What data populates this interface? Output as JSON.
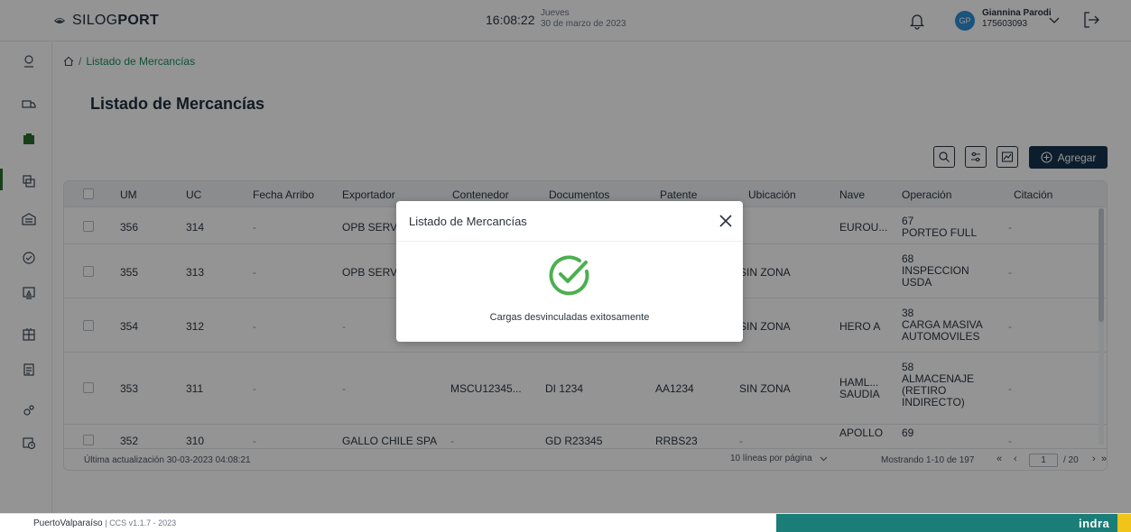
{
  "header": {
    "brand_light": "SILOG",
    "brand_bold": "PORT",
    "time": "16:08:22",
    "day": "Jueves",
    "date": "30 de marzo de 2023",
    "user_initials": "GP",
    "user_name": "Giannina Parodi",
    "user_id": "175603093"
  },
  "breadcrumb": {
    "separator": "/",
    "current": "Listado de Mercancías"
  },
  "page_title": "Listado de Mercancías",
  "toolbar": {
    "add_label": "Agregar"
  },
  "table": {
    "columns": [
      "UM",
      "UC",
      "Fecha Arribo",
      "Exportador",
      "Contenedor",
      "Documentos",
      "Patente",
      "Ubicación",
      "Nave",
      "Operación",
      "Citación"
    ],
    "rows": [
      {
        "um": "356",
        "uc": "314",
        "fecha": "-",
        "exportador": "OPB SERVIC",
        "contenedor": "",
        "documentos": "",
        "patente": "",
        "ubicacion": "",
        "nave": "EUROU...",
        "op_num": "67",
        "op_text": "PORTEO FULL",
        "citacion": "-"
      },
      {
        "um": "355",
        "uc": "313",
        "fecha": "-",
        "exportador": "OPB SERVIC",
        "contenedor": "",
        "documentos": "",
        "patente": "",
        "ubicacion": "SIN ZONA",
        "nave": "",
        "op_num": "68",
        "op_text": "INSPECCION USDA",
        "citacion": "-"
      },
      {
        "um": "354",
        "uc": "312",
        "fecha": "-",
        "exportador": "-",
        "contenedor": "",
        "documentos": "",
        "patente": "",
        "ubicacion": "SIN ZONA",
        "nave": "HERO A",
        "op_num": "38",
        "op_text": "CARGA MASIVA AUTOMOVILES",
        "citacion": "-"
      },
      {
        "um": "353",
        "uc": "311",
        "fecha": "-",
        "exportador": "-",
        "contenedor": "MSCU12345...",
        "documentos": "DI 1234",
        "patente": "AA1234",
        "ubicacion": "SIN ZONA",
        "nave": "HAML... SAUDIA",
        "op_num": "58",
        "op_text": "ALMACENAJE (RETIRO INDIRECTO)",
        "citacion": "-"
      },
      {
        "um": "352",
        "uc": "310",
        "fecha": "-",
        "exportador": "GALLO CHILE SPA",
        "contenedor": "-",
        "documentos": "GD R23345",
        "patente": "RRBS23",
        "ubicacion": "-",
        "nave": "APOLLO",
        "op_num": "69",
        "op_text": "",
        "citacion": "-"
      }
    ]
  },
  "footer_table": {
    "last_update": "Última actualización 30-03-2023 04:08:21",
    "per_page": "10 líneas por página",
    "showing": "Mostrando 1-10 de 197",
    "page": "1",
    "total_pages": "/ 20"
  },
  "modal": {
    "title": "Listado de Mercancías",
    "message": "Cargas desvinculadas exitosamente"
  },
  "footer": {
    "brand": "PuertoValparaíso",
    "version": "| CCS v1.1.7 - 2023",
    "partner": "indra"
  },
  "colors": {
    "primary_dark": "#16324f",
    "success_green": "#4caf50",
    "link_green": "#1a8f5e",
    "footer_teal": "#1a7d77",
    "footer_yellow": "#f0c419",
    "avatar_blue": "#2d8fd5"
  },
  "icons": {
    "sidebar": [
      "map-pin-icon",
      "truck-icon",
      "box-icon",
      "stack-icon",
      "warehouse-icon",
      "badge-icon",
      "monitor-icon",
      "grid-icon",
      "clipboard-icon",
      "gear-icon",
      "calendar-clock-icon"
    ]
  }
}
